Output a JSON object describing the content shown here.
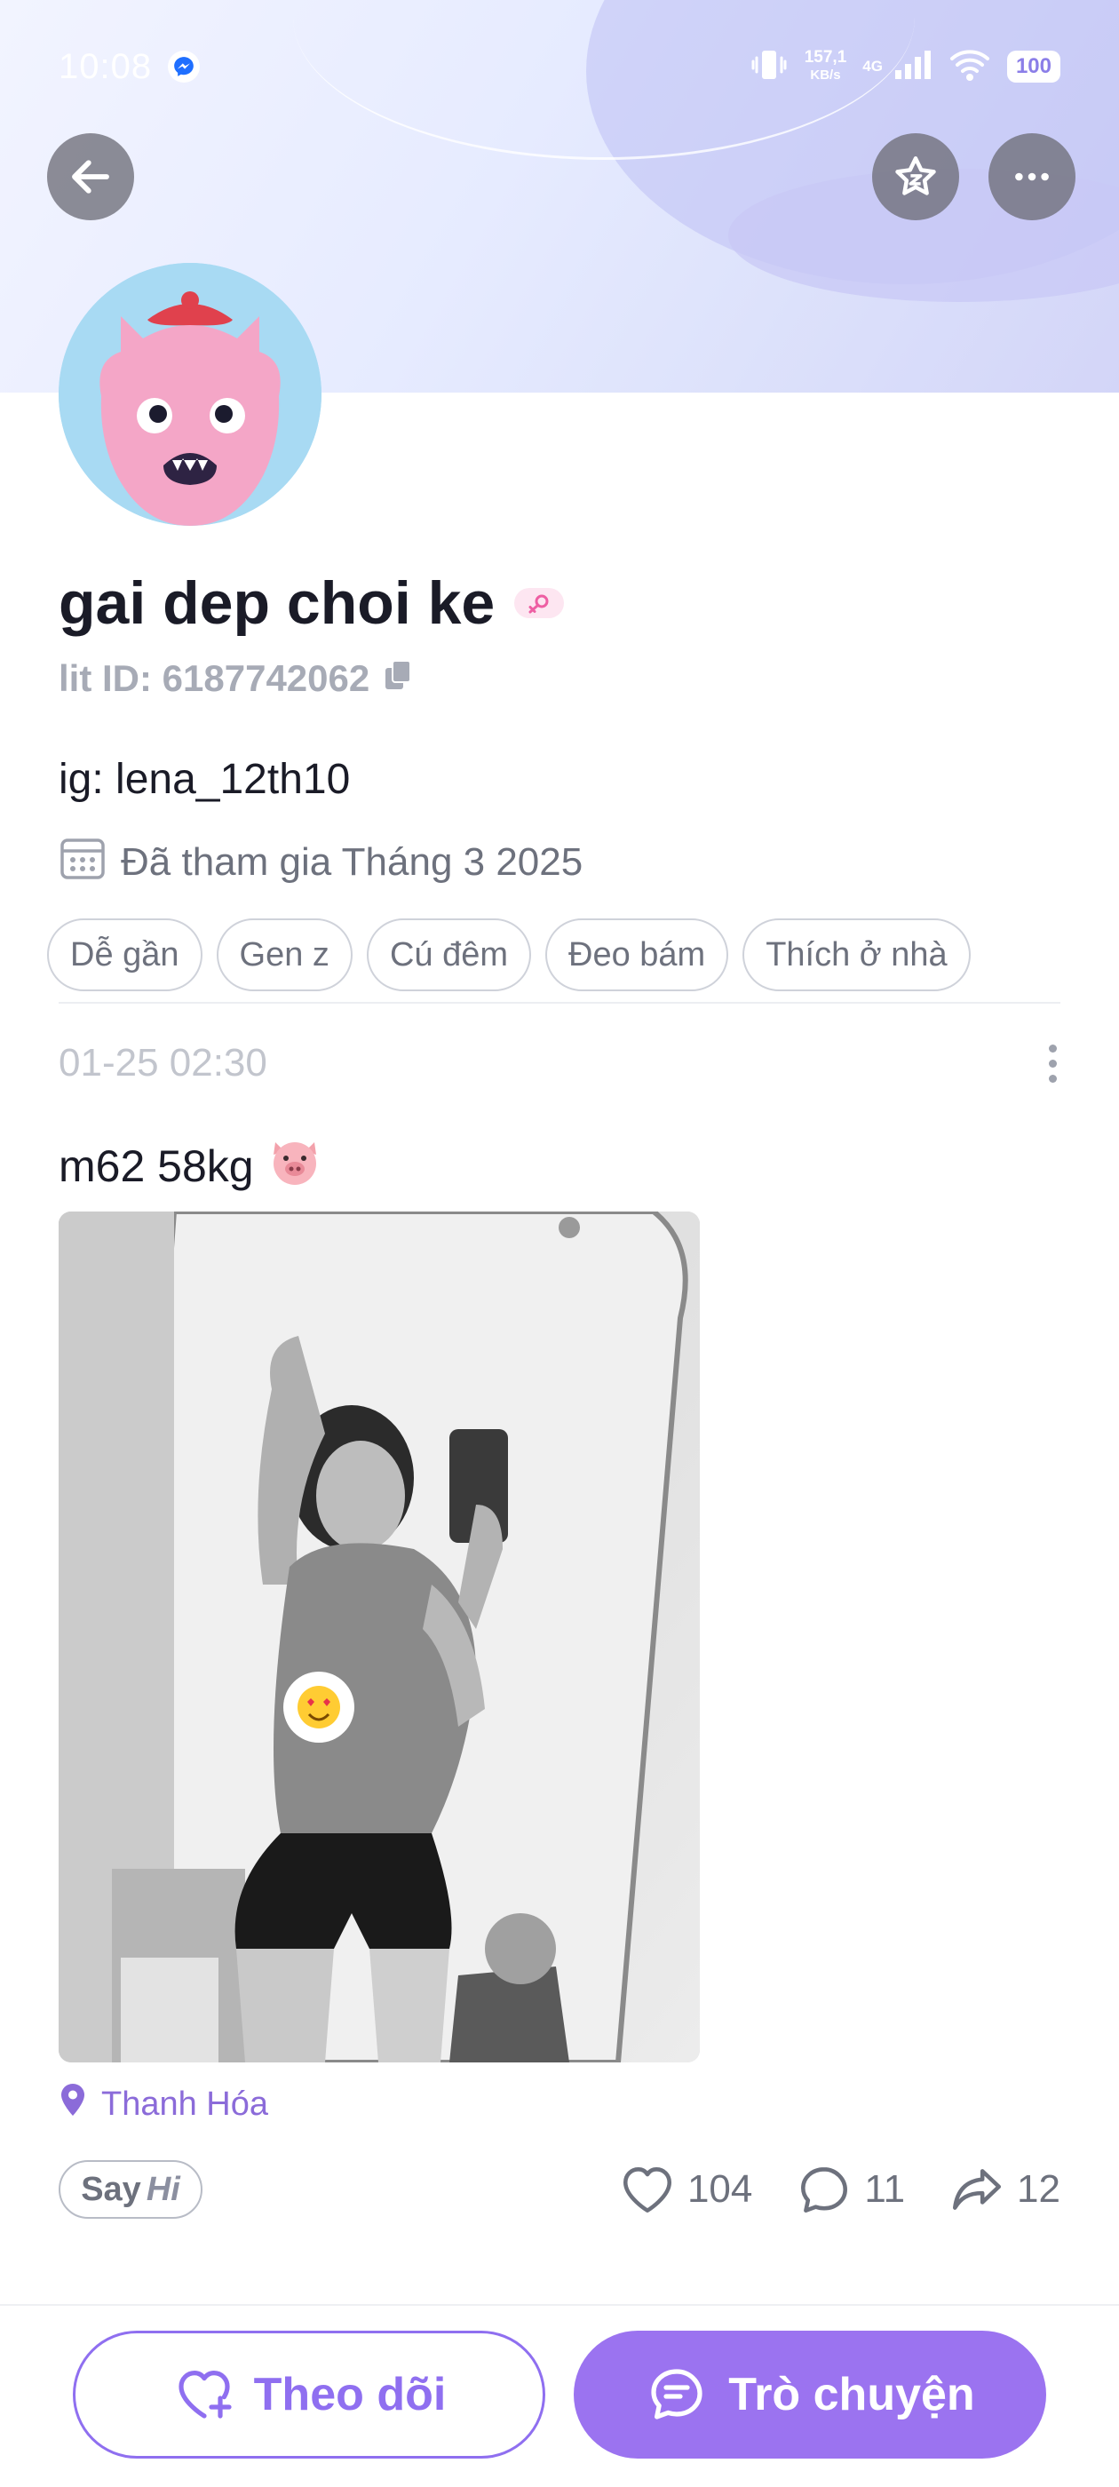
{
  "status_bar": {
    "time": "10:08",
    "speed_value": "157,1",
    "speed_unit": "KB/s",
    "network": "4G",
    "battery": "100"
  },
  "header": {
    "back_icon": "arrow-left-icon",
    "favorite_icon": "star-icon",
    "more_icon": "more-horizontal-icon"
  },
  "profile": {
    "name": "gai dep choi ke",
    "gender_icon": "female-icon",
    "lit_id": "lit ID: 6187742062",
    "bio": "ig: lena_12th10",
    "joined": "Đã tham gia Tháng 3 2025",
    "tags": [
      "Dễ gần",
      "Gen z",
      "Cú đêm",
      "Đeo bám",
      "Thích ở nhà"
    ]
  },
  "post": {
    "time": "01-25 02:30",
    "text": "m62 58kg",
    "emoji": "🐷",
    "location": "Thanh Hóa",
    "sayhi": {
      "say": "Say",
      "hi": "Hi"
    },
    "likes": "104",
    "comments": "11",
    "shares": "12"
  },
  "actions": {
    "follow_label": "Theo dõi",
    "chat_label": "Trò chuyện"
  },
  "colors": {
    "accent": "#9b73f0",
    "location": "#8b6bd9"
  }
}
